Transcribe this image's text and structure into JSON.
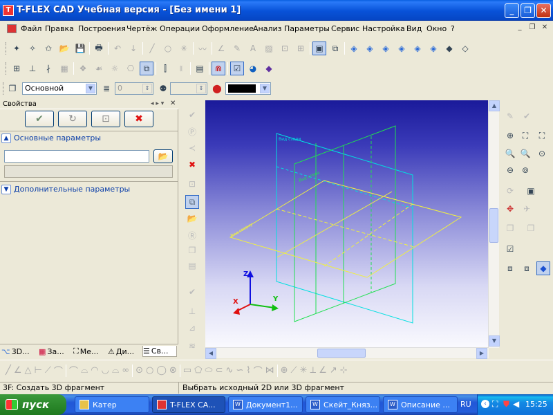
{
  "window": {
    "title": "T-FLEX CAD Учебная версия - [Без имени 1]",
    "icon": "app-icon"
  },
  "menu": [
    "Файл",
    "Правка",
    "Построения",
    "Чертёж",
    "Операции",
    "Оформление",
    "Анализ",
    "Параметры",
    "Сервис",
    "Настройка",
    "Вид",
    "Окно",
    "?"
  ],
  "props_bar": {
    "layer_value": "Основной",
    "thickness_value": "0",
    "color_value": "black"
  },
  "panel": {
    "title": "Свойства",
    "section_main": "Основные параметры",
    "section_extra": "Дополнительные параметры",
    "input_value": "",
    "tabs": [
      "3D...",
      "За...",
      "Ме...",
      "Ди...",
      "Св..."
    ]
  },
  "viewport": {
    "plane_labels": [
      "Вид сзади",
      "Вид слева",
      "Вид сверху"
    ],
    "axes": {
      "x": "X",
      "y": "Y",
      "z": "Z"
    },
    "colors": {
      "plane_front": "#00e0e0",
      "plane_side": "#20e050",
      "plane_top": "#f0f040",
      "axis_x": "#e01010",
      "axis_y": "#10c010",
      "axis_z": "#1010e0"
    }
  },
  "status": {
    "left": "3F: Создать 3D фрагмент",
    "hint": "Выбрать исходный 2D или 3D фрагмент"
  },
  "taskbar": {
    "start": "пуск",
    "tasks": [
      "Катер",
      "T-FLEX CA...",
      "Документ1...",
      "Скейт_Княз...",
      "Описание ..."
    ],
    "lang": "RU",
    "clock": "15:25"
  }
}
